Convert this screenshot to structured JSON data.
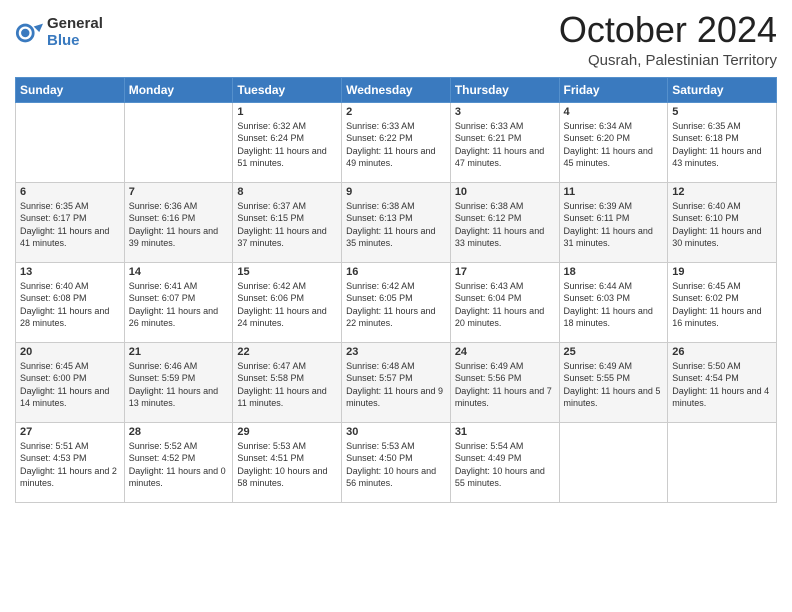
{
  "header": {
    "logo_general": "General",
    "logo_blue": "Blue",
    "month_title": "October 2024",
    "location": "Qusrah, Palestinian Territory"
  },
  "days_of_week": [
    "Sunday",
    "Monday",
    "Tuesday",
    "Wednesday",
    "Thursday",
    "Friday",
    "Saturday"
  ],
  "weeks": [
    [
      {
        "day": "",
        "sunrise": "",
        "sunset": "",
        "daylight": ""
      },
      {
        "day": "",
        "sunrise": "",
        "sunset": "",
        "daylight": ""
      },
      {
        "day": "1",
        "sunrise": "Sunrise: 6:32 AM",
        "sunset": "Sunset: 6:24 PM",
        "daylight": "Daylight: 11 hours and 51 minutes."
      },
      {
        "day": "2",
        "sunrise": "Sunrise: 6:33 AM",
        "sunset": "Sunset: 6:22 PM",
        "daylight": "Daylight: 11 hours and 49 minutes."
      },
      {
        "day": "3",
        "sunrise": "Sunrise: 6:33 AM",
        "sunset": "Sunset: 6:21 PM",
        "daylight": "Daylight: 11 hours and 47 minutes."
      },
      {
        "day": "4",
        "sunrise": "Sunrise: 6:34 AM",
        "sunset": "Sunset: 6:20 PM",
        "daylight": "Daylight: 11 hours and 45 minutes."
      },
      {
        "day": "5",
        "sunrise": "Sunrise: 6:35 AM",
        "sunset": "Sunset: 6:18 PM",
        "daylight": "Daylight: 11 hours and 43 minutes."
      }
    ],
    [
      {
        "day": "6",
        "sunrise": "Sunrise: 6:35 AM",
        "sunset": "Sunset: 6:17 PM",
        "daylight": "Daylight: 11 hours and 41 minutes."
      },
      {
        "day": "7",
        "sunrise": "Sunrise: 6:36 AM",
        "sunset": "Sunset: 6:16 PM",
        "daylight": "Daylight: 11 hours and 39 minutes."
      },
      {
        "day": "8",
        "sunrise": "Sunrise: 6:37 AM",
        "sunset": "Sunset: 6:15 PM",
        "daylight": "Daylight: 11 hours and 37 minutes."
      },
      {
        "day": "9",
        "sunrise": "Sunrise: 6:38 AM",
        "sunset": "Sunset: 6:13 PM",
        "daylight": "Daylight: 11 hours and 35 minutes."
      },
      {
        "day": "10",
        "sunrise": "Sunrise: 6:38 AM",
        "sunset": "Sunset: 6:12 PM",
        "daylight": "Daylight: 11 hours and 33 minutes."
      },
      {
        "day": "11",
        "sunrise": "Sunrise: 6:39 AM",
        "sunset": "Sunset: 6:11 PM",
        "daylight": "Daylight: 11 hours and 31 minutes."
      },
      {
        "day": "12",
        "sunrise": "Sunrise: 6:40 AM",
        "sunset": "Sunset: 6:10 PM",
        "daylight": "Daylight: 11 hours and 30 minutes."
      }
    ],
    [
      {
        "day": "13",
        "sunrise": "Sunrise: 6:40 AM",
        "sunset": "Sunset: 6:08 PM",
        "daylight": "Daylight: 11 hours and 28 minutes."
      },
      {
        "day": "14",
        "sunrise": "Sunrise: 6:41 AM",
        "sunset": "Sunset: 6:07 PM",
        "daylight": "Daylight: 11 hours and 26 minutes."
      },
      {
        "day": "15",
        "sunrise": "Sunrise: 6:42 AM",
        "sunset": "Sunset: 6:06 PM",
        "daylight": "Daylight: 11 hours and 24 minutes."
      },
      {
        "day": "16",
        "sunrise": "Sunrise: 6:42 AM",
        "sunset": "Sunset: 6:05 PM",
        "daylight": "Daylight: 11 hours and 22 minutes."
      },
      {
        "day": "17",
        "sunrise": "Sunrise: 6:43 AM",
        "sunset": "Sunset: 6:04 PM",
        "daylight": "Daylight: 11 hours and 20 minutes."
      },
      {
        "day": "18",
        "sunrise": "Sunrise: 6:44 AM",
        "sunset": "Sunset: 6:03 PM",
        "daylight": "Daylight: 11 hours and 18 minutes."
      },
      {
        "day": "19",
        "sunrise": "Sunrise: 6:45 AM",
        "sunset": "Sunset: 6:02 PM",
        "daylight": "Daylight: 11 hours and 16 minutes."
      }
    ],
    [
      {
        "day": "20",
        "sunrise": "Sunrise: 6:45 AM",
        "sunset": "Sunset: 6:00 PM",
        "daylight": "Daylight: 11 hours and 14 minutes."
      },
      {
        "day": "21",
        "sunrise": "Sunrise: 6:46 AM",
        "sunset": "Sunset: 5:59 PM",
        "daylight": "Daylight: 11 hours and 13 minutes."
      },
      {
        "day": "22",
        "sunrise": "Sunrise: 6:47 AM",
        "sunset": "Sunset: 5:58 PM",
        "daylight": "Daylight: 11 hours and 11 minutes."
      },
      {
        "day": "23",
        "sunrise": "Sunrise: 6:48 AM",
        "sunset": "Sunset: 5:57 PM",
        "daylight": "Daylight: 11 hours and 9 minutes."
      },
      {
        "day": "24",
        "sunrise": "Sunrise: 6:49 AM",
        "sunset": "Sunset: 5:56 PM",
        "daylight": "Daylight: 11 hours and 7 minutes."
      },
      {
        "day": "25",
        "sunrise": "Sunrise: 6:49 AM",
        "sunset": "Sunset: 5:55 PM",
        "daylight": "Daylight: 11 hours and 5 minutes."
      },
      {
        "day": "26",
        "sunrise": "Sunrise: 5:50 AM",
        "sunset": "Sunset: 4:54 PM",
        "daylight": "Daylight: 11 hours and 4 minutes."
      }
    ],
    [
      {
        "day": "27",
        "sunrise": "Sunrise: 5:51 AM",
        "sunset": "Sunset: 4:53 PM",
        "daylight": "Daylight: 11 hours and 2 minutes."
      },
      {
        "day": "28",
        "sunrise": "Sunrise: 5:52 AM",
        "sunset": "Sunset: 4:52 PM",
        "daylight": "Daylight: 11 hours and 0 minutes."
      },
      {
        "day": "29",
        "sunrise": "Sunrise: 5:53 AM",
        "sunset": "Sunset: 4:51 PM",
        "daylight": "Daylight: 10 hours and 58 minutes."
      },
      {
        "day": "30",
        "sunrise": "Sunrise: 5:53 AM",
        "sunset": "Sunset: 4:50 PM",
        "daylight": "Daylight: 10 hours and 56 minutes."
      },
      {
        "day": "31",
        "sunrise": "Sunrise: 5:54 AM",
        "sunset": "Sunset: 4:49 PM",
        "daylight": "Daylight: 10 hours and 55 minutes."
      },
      {
        "day": "",
        "sunrise": "",
        "sunset": "",
        "daylight": ""
      },
      {
        "day": "",
        "sunrise": "",
        "sunset": "",
        "daylight": ""
      }
    ]
  ]
}
